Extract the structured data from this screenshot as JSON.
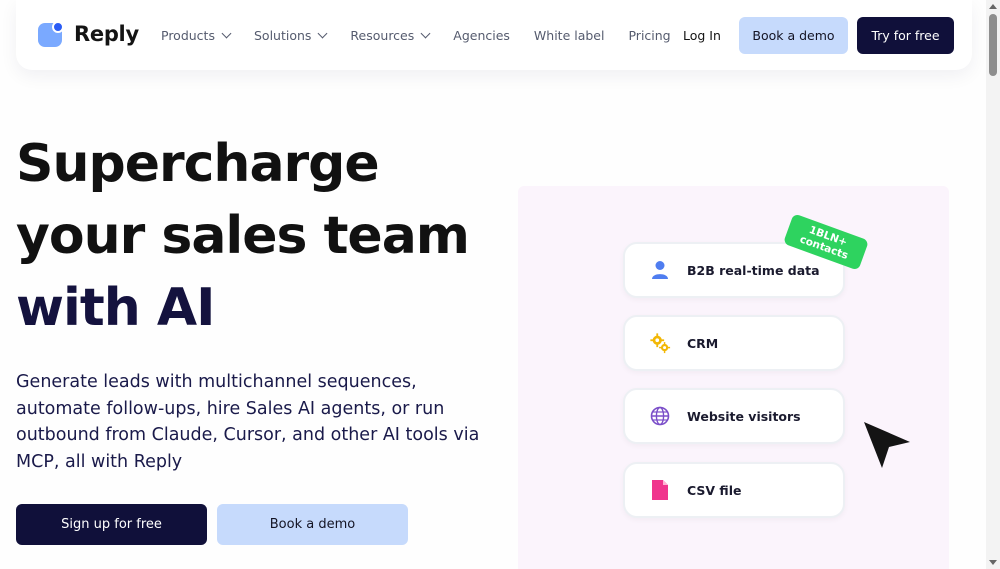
{
  "nav": {
    "logo_text": "Reply",
    "menu": [
      {
        "label": "Products",
        "dropdown": true
      },
      {
        "label": "Solutions",
        "dropdown": true
      },
      {
        "label": "Resources",
        "dropdown": true
      },
      {
        "label": "Agencies",
        "dropdown": false
      },
      {
        "label": "White label",
        "dropdown": false
      },
      {
        "label": "Pricing",
        "dropdown": false
      }
    ],
    "login": "Log In",
    "book_demo": "Book a demo",
    "try_free": "Try for free"
  },
  "hero": {
    "title_line1": "Supercharge",
    "title_line2": "your sales team",
    "title_line3": "with AI",
    "subtitle": "Generate leads with multichannel sequences, automate follow-ups, hire Sales AI agents, or run outbound from Claude, Cursor, and other AI tools via MCP, all with Reply",
    "signup": "Sign up for free",
    "book_demo": "Book a demo"
  },
  "illustration": {
    "badge_line1": "1BLN+",
    "badge_line2": "contacts",
    "sources": [
      {
        "label": "B2B real-time data",
        "icon": "person-icon"
      },
      {
        "label": "CRM",
        "icon": "gears-icon"
      },
      {
        "label": "Website visitors",
        "icon": "globe-icon"
      },
      {
        "label": "CSV file",
        "icon": "file-icon"
      }
    ]
  },
  "colors": {
    "primary_dark": "#10103a",
    "accent_light": "#c6dafc",
    "brand_blue": "#2a5cf5",
    "badge_green": "#2ed35f",
    "panel_bg": "#fbf4fc"
  }
}
